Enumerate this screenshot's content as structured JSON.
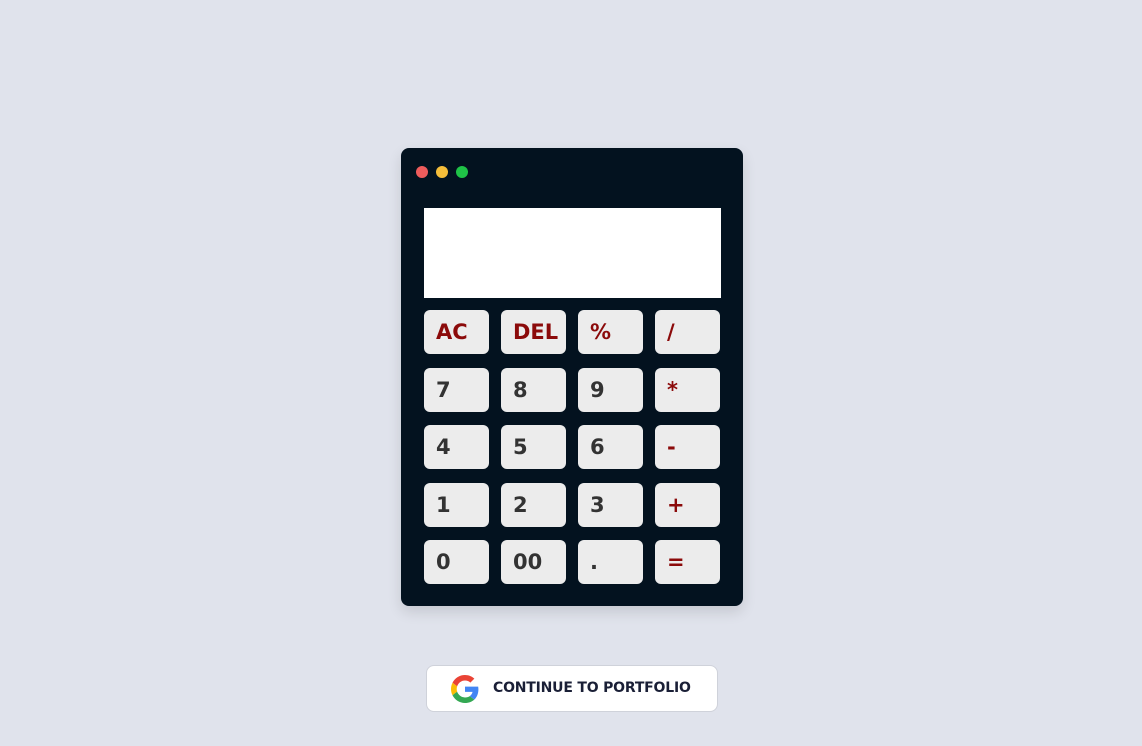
{
  "window_controls": {
    "close_color": "#ee5c5c",
    "minimize_color": "#f5be3a",
    "maximize_color": "#1fc347"
  },
  "display": {
    "value": ""
  },
  "keys": [
    {
      "label": "AC",
      "type": "op",
      "name": "all-clear"
    },
    {
      "label": "DEL",
      "type": "op",
      "name": "delete"
    },
    {
      "label": "%",
      "type": "op",
      "name": "percent"
    },
    {
      "label": "/",
      "type": "op",
      "name": "divide"
    },
    {
      "label": "7",
      "type": "num",
      "name": "7"
    },
    {
      "label": "8",
      "type": "num",
      "name": "8"
    },
    {
      "label": "9",
      "type": "num",
      "name": "9"
    },
    {
      "label": "*",
      "type": "op",
      "name": "multiply"
    },
    {
      "label": "4",
      "type": "num",
      "name": "4"
    },
    {
      "label": "5",
      "type": "num",
      "name": "5"
    },
    {
      "label": "6",
      "type": "num",
      "name": "6"
    },
    {
      "label": "-",
      "type": "op",
      "name": "subtract"
    },
    {
      "label": "1",
      "type": "num",
      "name": "1"
    },
    {
      "label": "2",
      "type": "num",
      "name": "2"
    },
    {
      "label": "3",
      "type": "num",
      "name": "3"
    },
    {
      "label": "+",
      "type": "op",
      "name": "add"
    },
    {
      "label": "0",
      "type": "num",
      "name": "0"
    },
    {
      "label": "00",
      "type": "num",
      "name": "double-zero"
    },
    {
      "label": ".",
      "type": "num",
      "name": "decimal"
    },
    {
      "label": "=",
      "type": "op",
      "name": "equals"
    }
  ],
  "colors": {
    "page_bg": "#e0e3ec",
    "calculator_bg": "#03121f",
    "key_bg": "#ececec",
    "operator_text": "#8b0a0a",
    "number_text": "#333333"
  },
  "footer": {
    "button_label": "CONTINUE TO PORTFOLIO",
    "icon": "google-g-icon"
  }
}
